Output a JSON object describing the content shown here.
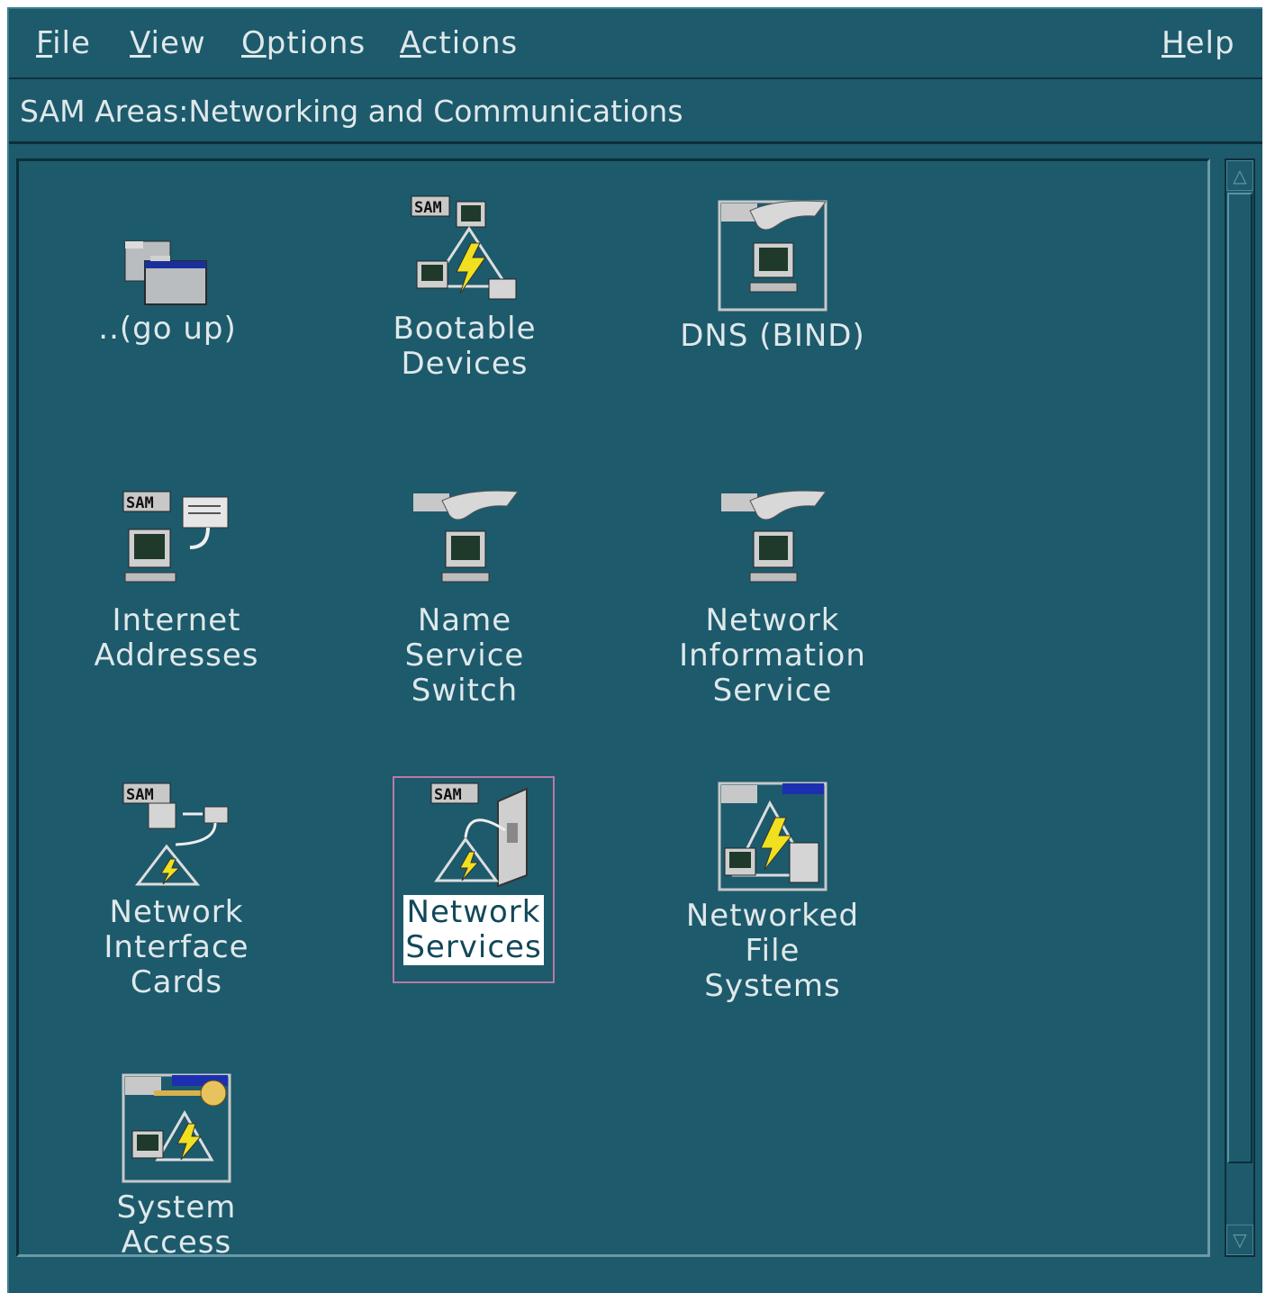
{
  "menubar": {
    "file": "File",
    "view": "View",
    "options": "Options",
    "actions": "Actions",
    "help": "Help"
  },
  "breadcrumb": "SAM Areas:Networking and Communications",
  "badge": "SAM",
  "items": [
    {
      "label": "..(go up)"
    },
    {
      "label": "Bootable\nDevices"
    },
    {
      "label": "DNS (BIND)"
    },
    {
      "label": "Internet\nAddresses"
    },
    {
      "label": "Name Service\nSwitch"
    },
    {
      "label": "Network\nInformation\nService"
    },
    {
      "label": "Network\nInterface\nCards"
    },
    {
      "label": "Network\nServices",
      "selected": true
    },
    {
      "label": "Networked\nFile Systems"
    },
    {
      "label": "System Access"
    }
  ],
  "colors": {
    "background": "#1d5a6c",
    "text": "#dfe8ea",
    "selection_border": "#b87aa6"
  }
}
